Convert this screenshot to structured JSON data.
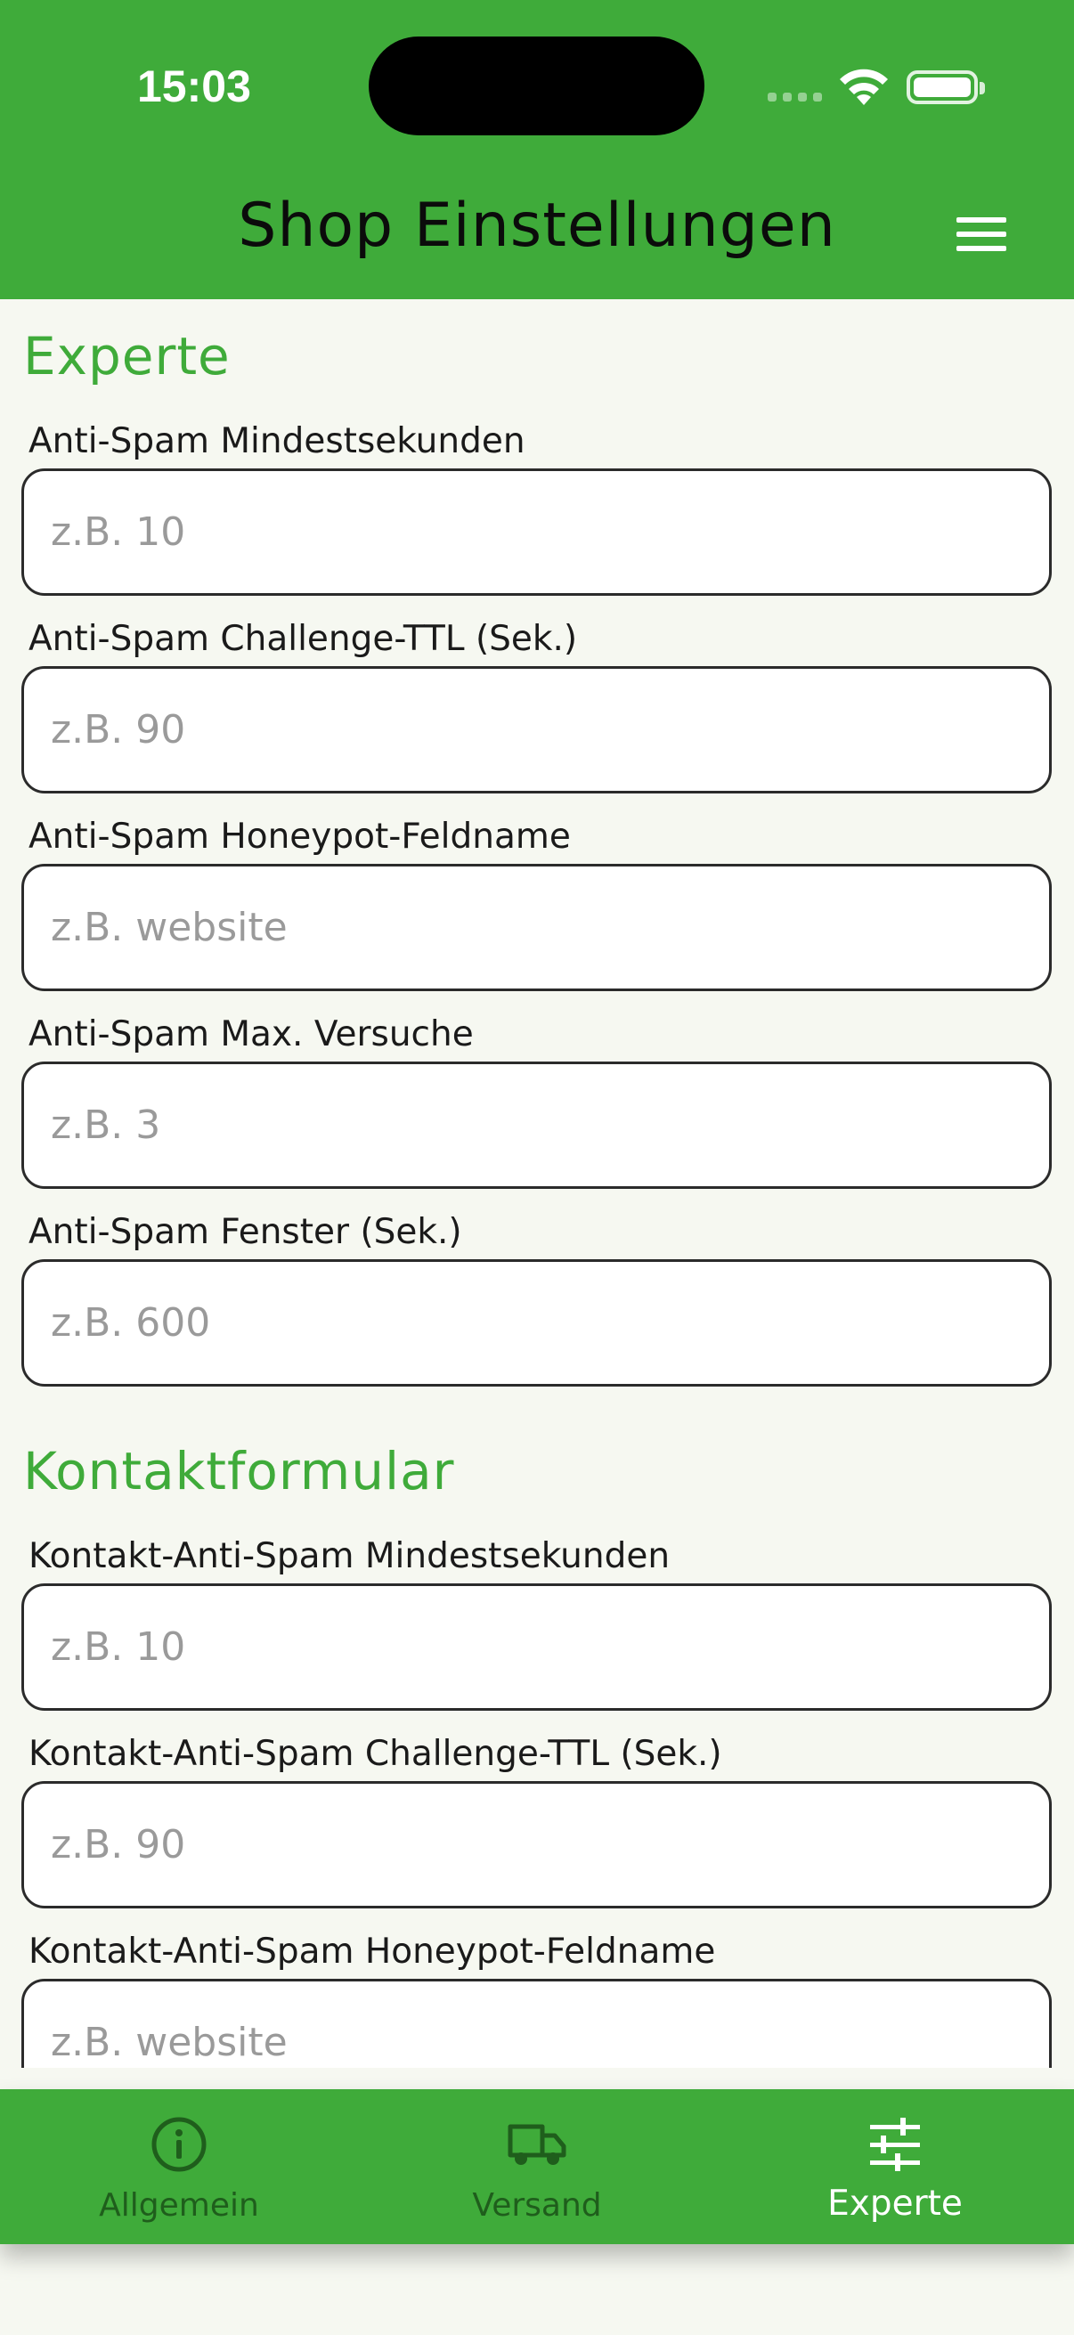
{
  "status_bar": {
    "time": "15:03"
  },
  "header": {
    "title": "Shop Einstellungen"
  },
  "sections": [
    {
      "title": "Experte",
      "fields": [
        {
          "label": "Anti-Spam Mindestsekunden",
          "placeholder": "z.B. 10",
          "value": ""
        },
        {
          "label": "Anti-Spam Challenge-TTL (Sek.)",
          "placeholder": "z.B. 90",
          "value": ""
        },
        {
          "label": "Anti-Spam Honeypot-Feldname",
          "placeholder": "z.B. website",
          "value": ""
        },
        {
          "label": "Anti-Spam Max. Versuche",
          "placeholder": "z.B. 3",
          "value": ""
        },
        {
          "label": "Anti-Spam Fenster (Sek.)",
          "placeholder": "z.B. 600",
          "value": ""
        }
      ]
    },
    {
      "title": "Kontaktformular",
      "fields": [
        {
          "label": "Kontakt-Anti-Spam Mindestsekunden",
          "placeholder": "z.B. 10",
          "value": ""
        },
        {
          "label": "Kontakt-Anti-Spam Challenge-TTL (Sek.)",
          "placeholder": "z.B. 90",
          "value": ""
        },
        {
          "label": "Kontakt-Anti-Spam Honeypot-Feldname",
          "placeholder": "z.B. website",
          "value": ""
        }
      ]
    }
  ],
  "tabs": [
    {
      "label": "Allgemein",
      "icon": "info-circle-icon",
      "active": false
    },
    {
      "label": "Versand",
      "icon": "truck-icon",
      "active": false
    },
    {
      "label": "Experte",
      "icon": "sliders-icon",
      "active": true
    }
  ],
  "colors": {
    "primary_green": "#3fab3a",
    "background": "#f6f8f1",
    "inactive_tab": "#1f5e1c",
    "active_tab": "#ffffff"
  }
}
